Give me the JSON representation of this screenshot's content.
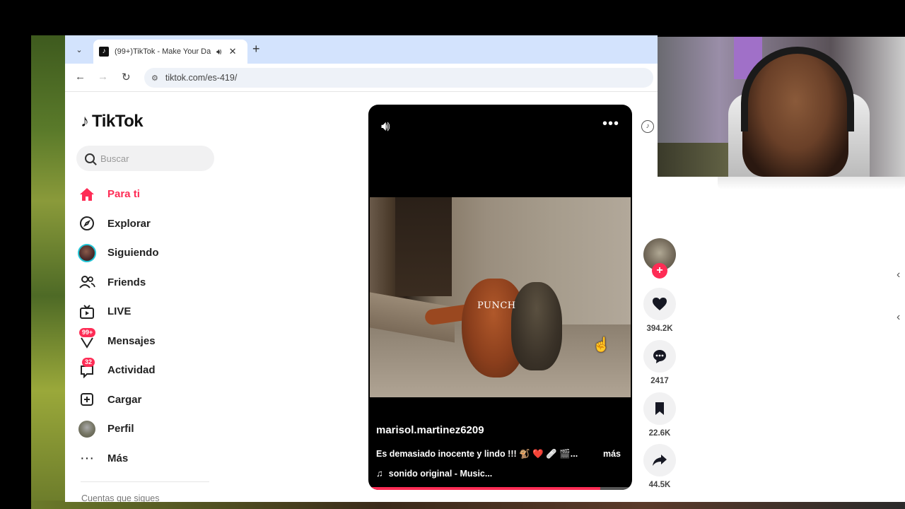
{
  "browser": {
    "tab_title": "(99+)TikTok - Make Your Da",
    "url": "tiktok.com/es-419/"
  },
  "logo": {
    "text": "TikTok"
  },
  "search": {
    "placeholder": "Buscar"
  },
  "nav": {
    "items": [
      {
        "label": "Para ti",
        "icon": "home-icon",
        "active": true
      },
      {
        "label": "Explorar",
        "icon": "compass-icon"
      },
      {
        "label": "Siguiendo",
        "icon": "following-avatar"
      },
      {
        "label": "Friends",
        "icon": "friends-icon"
      },
      {
        "label": "LIVE",
        "icon": "live-tv-icon"
      },
      {
        "label": "Mensajes",
        "icon": "inbox-icon",
        "badge": "99+"
      },
      {
        "label": "Actividad",
        "icon": "activity-icon",
        "badge": "32"
      },
      {
        "label": "Cargar",
        "icon": "upload-icon"
      },
      {
        "label": "Perfil",
        "icon": "profile-avatar"
      },
      {
        "label": "Más",
        "icon": "more-dots-icon"
      }
    ],
    "following_heading": "Cuentas que sigues"
  },
  "video": {
    "overlay_text": "PUNCH",
    "author": "marisol.martinez6209",
    "caption": "Es demasiado inocente y lindo !!! 🐒 ❤️ 🩹 🎬...",
    "more_label": "más",
    "music": "sonido original - Music...",
    "progress": 0.88
  },
  "actions": {
    "likes": "394.2K",
    "comments": "2417",
    "saves": "22.6K",
    "shares": "44.5K"
  },
  "colors": {
    "brand": "#fe2c55",
    "tabstrip": "#d3e3fd"
  }
}
